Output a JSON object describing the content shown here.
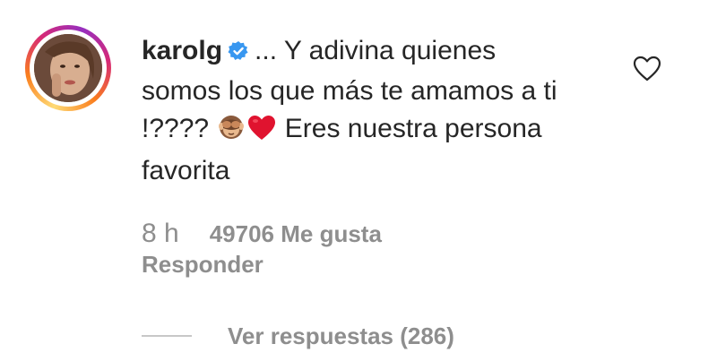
{
  "comment": {
    "username": "karolg",
    "text_part1": "... Y adivina quienes somos los que más te amamos a ti !????",
    "text_part2": "Eres nuestra persona favorita"
  },
  "meta": {
    "time": "8 h",
    "likes": "49706 Me gusta",
    "reply_label": "Responder",
    "view_replies_label": "Ver respuestas (286)"
  },
  "icons": {
    "verified": "verified-badge-icon",
    "emoji1": "see-no-evil-monkey-icon",
    "emoji2": "red-heart-icon",
    "like": "heart-outline-icon"
  },
  "colors": {
    "text": "#262626",
    "secondary": "#8e8e8e",
    "verified_blue": "#3897f0",
    "heart_red": "#e0132f"
  }
}
